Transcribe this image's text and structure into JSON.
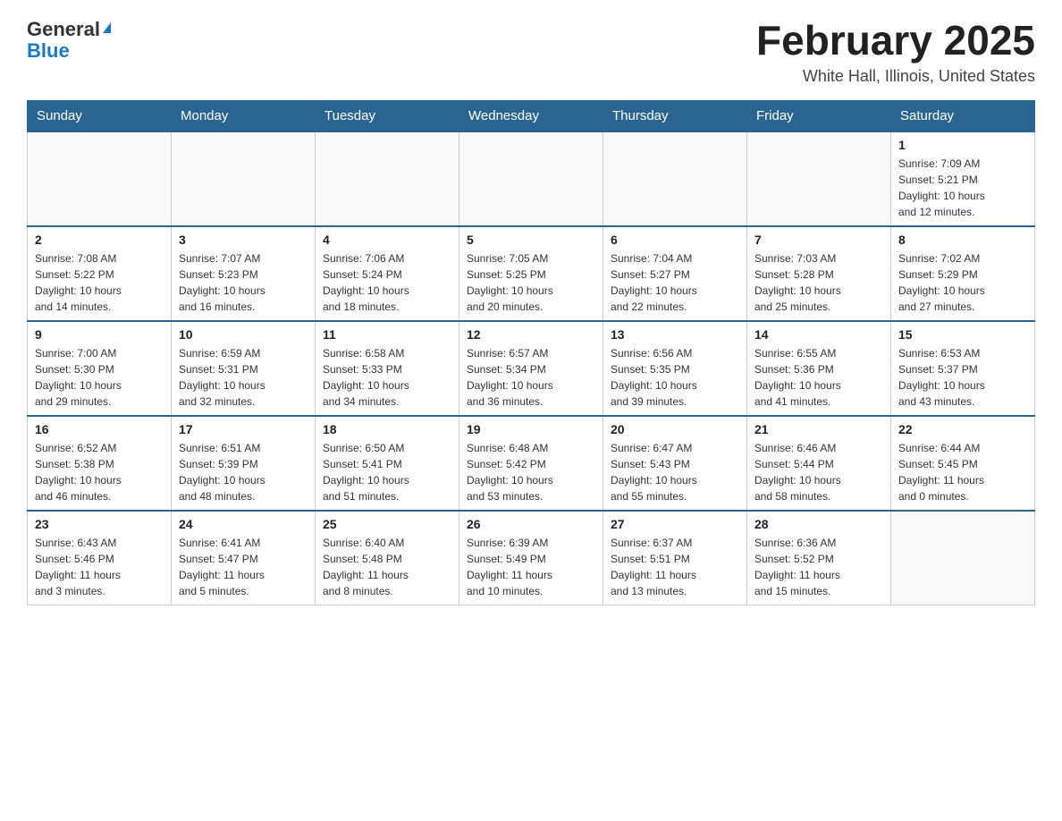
{
  "header": {
    "logo": {
      "line1": "General",
      "arrow": "▶",
      "line2": "Blue"
    },
    "title": "February 2025",
    "subtitle": "White Hall, Illinois, United States"
  },
  "weekdays": [
    "Sunday",
    "Monday",
    "Tuesday",
    "Wednesday",
    "Thursday",
    "Friday",
    "Saturday"
  ],
  "weeks": [
    [
      {
        "day": "",
        "info": ""
      },
      {
        "day": "",
        "info": ""
      },
      {
        "day": "",
        "info": ""
      },
      {
        "day": "",
        "info": ""
      },
      {
        "day": "",
        "info": ""
      },
      {
        "day": "",
        "info": ""
      },
      {
        "day": "1",
        "info": "Sunrise: 7:09 AM\nSunset: 5:21 PM\nDaylight: 10 hours\nand 12 minutes."
      }
    ],
    [
      {
        "day": "2",
        "info": "Sunrise: 7:08 AM\nSunset: 5:22 PM\nDaylight: 10 hours\nand 14 minutes."
      },
      {
        "day": "3",
        "info": "Sunrise: 7:07 AM\nSunset: 5:23 PM\nDaylight: 10 hours\nand 16 minutes."
      },
      {
        "day": "4",
        "info": "Sunrise: 7:06 AM\nSunset: 5:24 PM\nDaylight: 10 hours\nand 18 minutes."
      },
      {
        "day": "5",
        "info": "Sunrise: 7:05 AM\nSunset: 5:25 PM\nDaylight: 10 hours\nand 20 minutes."
      },
      {
        "day": "6",
        "info": "Sunrise: 7:04 AM\nSunset: 5:27 PM\nDaylight: 10 hours\nand 22 minutes."
      },
      {
        "day": "7",
        "info": "Sunrise: 7:03 AM\nSunset: 5:28 PM\nDaylight: 10 hours\nand 25 minutes."
      },
      {
        "day": "8",
        "info": "Sunrise: 7:02 AM\nSunset: 5:29 PM\nDaylight: 10 hours\nand 27 minutes."
      }
    ],
    [
      {
        "day": "9",
        "info": "Sunrise: 7:00 AM\nSunset: 5:30 PM\nDaylight: 10 hours\nand 29 minutes."
      },
      {
        "day": "10",
        "info": "Sunrise: 6:59 AM\nSunset: 5:31 PM\nDaylight: 10 hours\nand 32 minutes."
      },
      {
        "day": "11",
        "info": "Sunrise: 6:58 AM\nSunset: 5:33 PM\nDaylight: 10 hours\nand 34 minutes."
      },
      {
        "day": "12",
        "info": "Sunrise: 6:57 AM\nSunset: 5:34 PM\nDaylight: 10 hours\nand 36 minutes."
      },
      {
        "day": "13",
        "info": "Sunrise: 6:56 AM\nSunset: 5:35 PM\nDaylight: 10 hours\nand 39 minutes."
      },
      {
        "day": "14",
        "info": "Sunrise: 6:55 AM\nSunset: 5:36 PM\nDaylight: 10 hours\nand 41 minutes."
      },
      {
        "day": "15",
        "info": "Sunrise: 6:53 AM\nSunset: 5:37 PM\nDaylight: 10 hours\nand 43 minutes."
      }
    ],
    [
      {
        "day": "16",
        "info": "Sunrise: 6:52 AM\nSunset: 5:38 PM\nDaylight: 10 hours\nand 46 minutes."
      },
      {
        "day": "17",
        "info": "Sunrise: 6:51 AM\nSunset: 5:39 PM\nDaylight: 10 hours\nand 48 minutes."
      },
      {
        "day": "18",
        "info": "Sunrise: 6:50 AM\nSunset: 5:41 PM\nDaylight: 10 hours\nand 51 minutes."
      },
      {
        "day": "19",
        "info": "Sunrise: 6:48 AM\nSunset: 5:42 PM\nDaylight: 10 hours\nand 53 minutes."
      },
      {
        "day": "20",
        "info": "Sunrise: 6:47 AM\nSunset: 5:43 PM\nDaylight: 10 hours\nand 55 minutes."
      },
      {
        "day": "21",
        "info": "Sunrise: 6:46 AM\nSunset: 5:44 PM\nDaylight: 10 hours\nand 58 minutes."
      },
      {
        "day": "22",
        "info": "Sunrise: 6:44 AM\nSunset: 5:45 PM\nDaylight: 11 hours\nand 0 minutes."
      }
    ],
    [
      {
        "day": "23",
        "info": "Sunrise: 6:43 AM\nSunset: 5:46 PM\nDaylight: 11 hours\nand 3 minutes."
      },
      {
        "day": "24",
        "info": "Sunrise: 6:41 AM\nSunset: 5:47 PM\nDaylight: 11 hours\nand 5 minutes."
      },
      {
        "day": "25",
        "info": "Sunrise: 6:40 AM\nSunset: 5:48 PM\nDaylight: 11 hours\nand 8 minutes."
      },
      {
        "day": "26",
        "info": "Sunrise: 6:39 AM\nSunset: 5:49 PM\nDaylight: 11 hours\nand 10 minutes."
      },
      {
        "day": "27",
        "info": "Sunrise: 6:37 AM\nSunset: 5:51 PM\nDaylight: 11 hours\nand 13 minutes."
      },
      {
        "day": "28",
        "info": "Sunrise: 6:36 AM\nSunset: 5:52 PM\nDaylight: 11 hours\nand 15 minutes."
      },
      {
        "day": "",
        "info": ""
      }
    ]
  ]
}
